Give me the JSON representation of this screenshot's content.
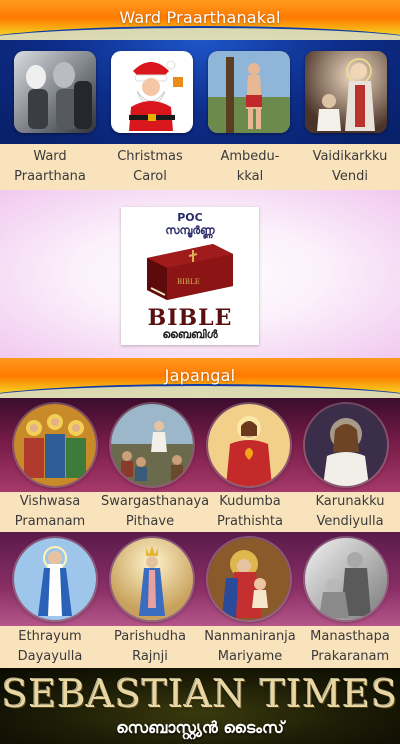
{
  "sections": {
    "ward": {
      "title": "Ward Praarthanakal"
    },
    "japangal": {
      "title": "Japangal"
    }
  },
  "ward_items": [
    {
      "line1": "Ward",
      "line2": "Praarthana",
      "icon": "praying-people-photo"
    },
    {
      "line1": "Christmas",
      "line2": "Carol",
      "icon": "santa-claus-illustration"
    },
    {
      "line1": "Ambedu-",
      "line2": "kkal",
      "icon": "saint-sebastian-painting"
    },
    {
      "line1": "Vaidikarkku",
      "line2": "Vendi",
      "icon": "priest-painting"
    }
  ],
  "bible_card": {
    "publisher": "POC",
    "subtitle_ml": "സമ്പൂർണ്ണ",
    "title": "BIBLE",
    "title_ml": "ബൈബിൾ"
  },
  "japangal_row1": [
    {
      "line1": "Vishwasa",
      "line2": "Pramanam",
      "icon": "apostles-painting"
    },
    {
      "line1": "Swargasthanaya",
      "line2": "Pithave",
      "icon": "sermon-on-mount-painting"
    },
    {
      "line1": "Kudumba",
      "line2": "Prathishta",
      "icon": "sacred-heart-painting"
    },
    {
      "line1": "Karunakku",
      "line2": "Vendiyulla",
      "icon": "divine-mercy-painting"
    }
  ],
  "japangal_row2": [
    {
      "line1": "Ethrayum",
      "line2": "Dayayulla",
      "icon": "mary-immaculate-painting"
    },
    {
      "line1": "Parishudha",
      "line2": "Rajnji",
      "icon": "queen-mary-painting"
    },
    {
      "line1": "Nanmaniranja",
      "line2": "Mariyame",
      "icon": "mary-with-child-painting"
    },
    {
      "line1": "Manasthapa",
      "line2": "Prakaranam",
      "icon": "prodigal-son-painting"
    }
  ],
  "footer": {
    "brand": "SEBASTIAN TIMES",
    "brand_ml": "സെബാസ്റ്റ്യൻ ടൈംസ്"
  },
  "colors": {
    "label_bg": "#f9e3bd",
    "banner_orange": "#ff7a00",
    "banner_blue": "#0f3fb0"
  }
}
